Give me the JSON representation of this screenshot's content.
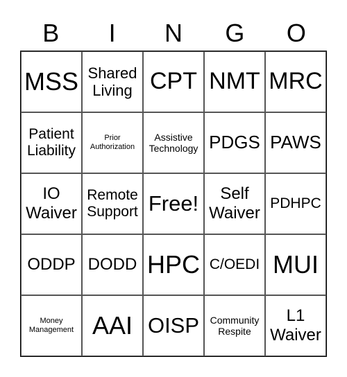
{
  "header": [
    "B",
    "I",
    "N",
    "G",
    "O"
  ],
  "cells": [
    "MSS",
    "Shared Living",
    "CPT",
    "NMT",
    "MRC",
    "Patient Liability",
    "Prior Authorization",
    "Assistive Technology",
    "PDGS",
    "PAWS",
    "IO Waiver",
    "Remote Support",
    "Free!",
    "Self Waiver",
    "PDHPC",
    "ODDP",
    "DODD",
    "HPC",
    "C/OEDI",
    "MUI",
    "Money Management",
    "AAI",
    "OISP",
    "Community Respite",
    "L1 Waiver"
  ]
}
